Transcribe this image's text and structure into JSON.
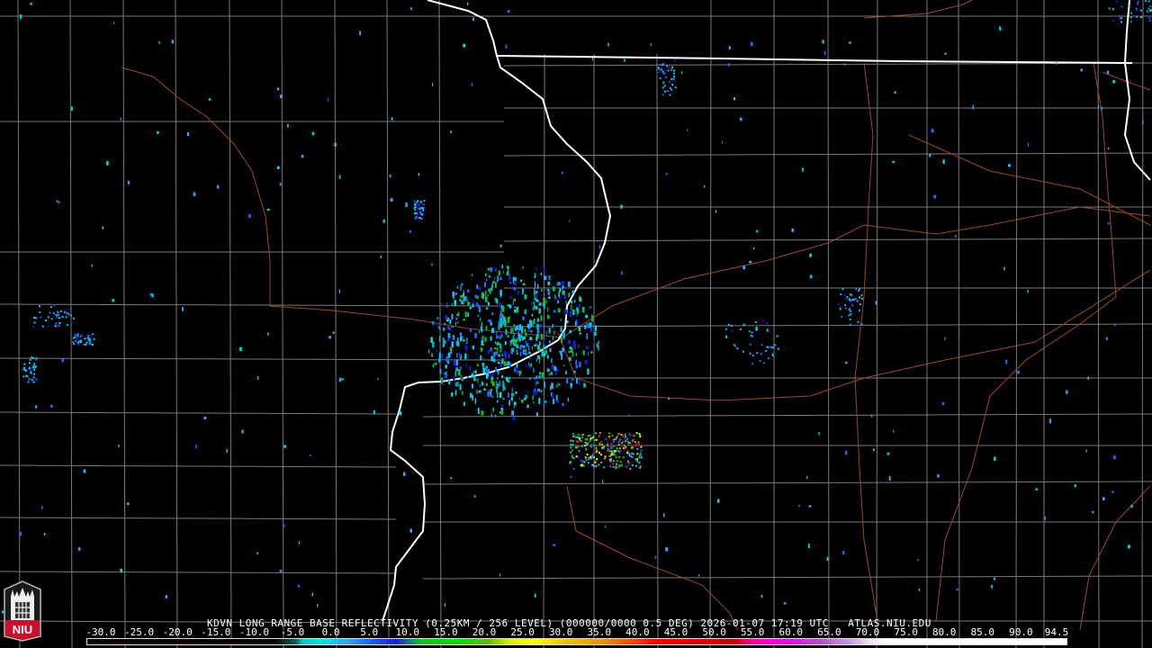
{
  "product": {
    "caption": "KDVN LONG RANGE BASE REFLECTIVITY (0.25KM / 256 LEVEL) (000000/0000 0.5 DEG) 2026-01-07 17:19 UTC   ATLAS.NIU.EDU"
  },
  "legend": {
    "unit_labels": [
      "-30.0",
      "-25.0",
      "-20.0",
      "-15.0",
      "-10.0",
      "-5.0",
      "0.0",
      "5.0",
      "10.0",
      "15.0",
      "20.0",
      "25.0",
      "30.0",
      "35.0",
      "40.0",
      "45.0",
      "50.0",
      "55.0",
      "60.0",
      "65.0",
      "70.0",
      "75.0",
      "80.0",
      "85.0",
      "90.0",
      "94.5"
    ],
    "range": [
      -30,
      94.5
    ]
  },
  "logo": {
    "text": "NIU"
  },
  "colors": {
    "state_border": "#ffffff",
    "county_border": "#808080",
    "highway": "#a0522d",
    "radar_palette": [
      "#00c8d0",
      "#00e0f0",
      "#30a8ff",
      "#1a6cff",
      "#1020e0",
      "#10c020",
      "#00e000",
      "#d0f000",
      "#ffff00",
      "#f09000",
      "#ff0000"
    ]
  }
}
